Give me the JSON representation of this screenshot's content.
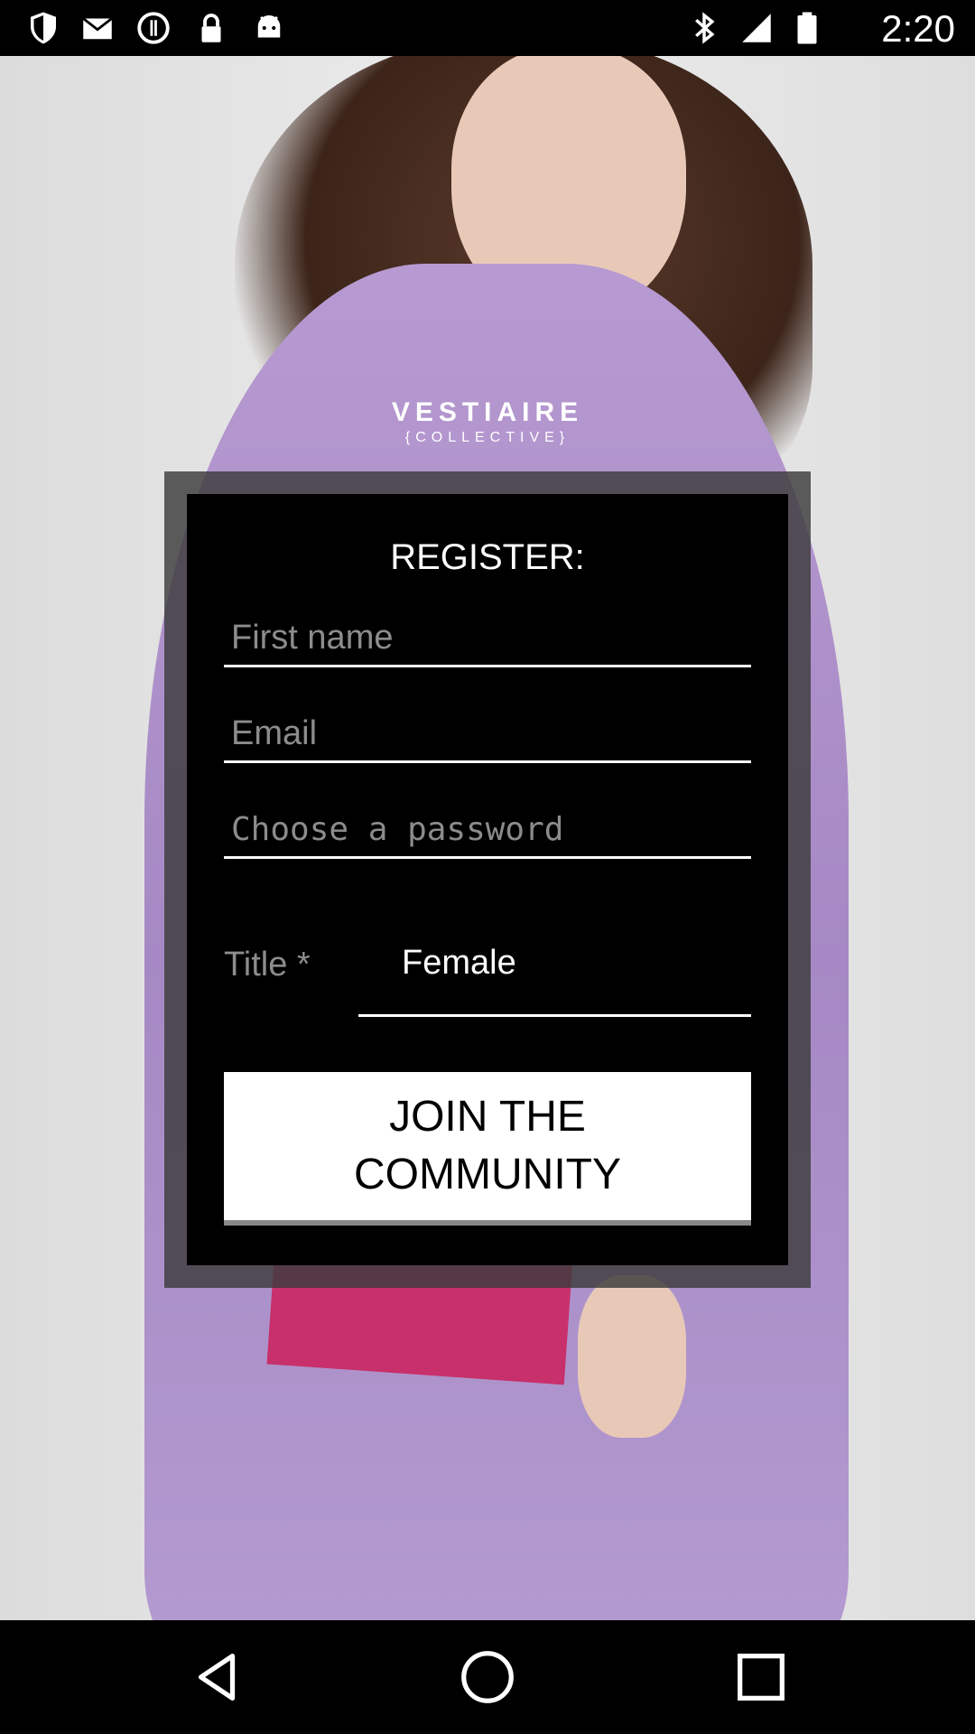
{
  "status_bar": {
    "time": "2:20",
    "left_icons": [
      "shield-icon",
      "mail-icon",
      "sync-icon",
      "lock-icon",
      "android-icon"
    ],
    "right_icons": [
      "bluetooth-icon",
      "signal-icon",
      "battery-icon"
    ]
  },
  "brand": {
    "name": "VESTIAIRE",
    "sub": "{COLLECTIVE}"
  },
  "register": {
    "title": "REGISTER:",
    "first_name_placeholder": "First name",
    "email_placeholder": "Email",
    "password_placeholder": "Choose a password",
    "title_label": "Title *",
    "title_value": "Female",
    "join_label": "JOIN THE COMMUNITY"
  },
  "colors": {
    "panel": "#000000",
    "placeholder": "#8c8c8c",
    "button": "#ffffff"
  },
  "nav_bar": {
    "icons": [
      "back-icon",
      "home-icon",
      "recents-icon"
    ]
  }
}
